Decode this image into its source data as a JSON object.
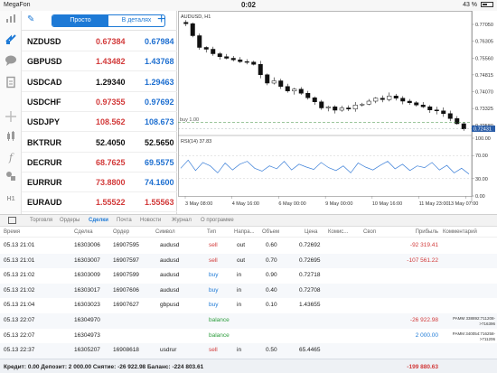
{
  "status": {
    "carrier": "MegaFon",
    "time": "0:02",
    "battery": "43 %"
  },
  "rail": {
    "icons": [
      "trade-icon",
      "accounts-icon",
      "chat-icon",
      "document-icon",
      "crosshair-icon",
      "candles-icon",
      "function-icon",
      "shapes-icon",
      "timeframe-icon"
    ],
    "timeframe": "H1"
  },
  "quotes": {
    "tab_simple": "Просто",
    "tab_details": "В деталях",
    "rows": [
      {
        "symbol": "NZDUSD",
        "bid": "0.67384",
        "ask": "0.67984",
        "bid_dir": "down",
        "ask_dir": "up"
      },
      {
        "symbol": "GBPUSD",
        "bid": "1.43482",
        "ask": "1.43768",
        "bid_dir": "down",
        "ask_dir": "up"
      },
      {
        "symbol": "USDCAD",
        "bid": "1.29340",
        "ask": "1.29463",
        "bid_dir": "flat",
        "ask_dir": "up"
      },
      {
        "symbol": "USDCHF",
        "bid": "0.97355",
        "ask": "0.97692",
        "bid_dir": "down",
        "ask_dir": "up"
      },
      {
        "symbol": "USDJPY",
        "bid": "108.562",
        "ask": "108.673",
        "bid_dir": "down",
        "ask_dir": "up"
      },
      {
        "symbol": "BKTRUR",
        "bid": "52.4050",
        "ask": "52.5650",
        "bid_dir": "flat",
        "ask_dir": "flat"
      },
      {
        "symbol": "DECRUR",
        "bid": "68.7625",
        "ask": "69.5575",
        "bid_dir": "down",
        "ask_dir": "up"
      },
      {
        "symbol": "EURRUR",
        "bid": "73.8800",
        "ask": "74.1600",
        "bid_dir": "down",
        "ask_dir": "up"
      },
      {
        "symbol": "EURAUD",
        "bid": "1.55522",
        "ask": "1.55563",
        "bid_dir": "down",
        "ask_dir": "down"
      }
    ]
  },
  "chart": {
    "title": "AUDUSD, H1",
    "price_ticks": [
      "0.77050",
      "0.76305",
      "0.75560",
      "0.74815",
      "0.74070",
      "0.73325",
      "0.72580"
    ],
    "current_price": "0.72431",
    "buy_label": "buy 1.00",
    "rsi_label": "RSI(14) 37.83",
    "rsi_ticks": [
      "100.00",
      "70.00",
      "30.00",
      "0.00"
    ],
    "time_ticks": [
      "3 May 08:00",
      "4 May 16:00",
      "6 May 00:00",
      "9 May 00:00",
      "10 May 16:00",
      "11 May 23:00",
      "13 May 07:00"
    ]
  },
  "chart_data": {
    "type": "candlestick",
    "title": "AUDUSD, H1",
    "ylim": [
      0.7213,
      0.7745
    ],
    "close_path": [
      0.7708,
      0.7655,
      0.7603,
      0.7595,
      0.7575,
      0.7562,
      0.7555,
      0.7548,
      0.754,
      0.7538,
      0.7528,
      0.7482,
      0.7445,
      0.7455,
      0.743,
      0.741,
      0.7418,
      0.74,
      0.738,
      0.7362,
      0.7335,
      0.734,
      0.7325,
      0.7335,
      0.733,
      0.7348,
      0.7352,
      0.7365,
      0.7378,
      0.7372,
      0.7388,
      0.7378,
      0.7365,
      0.7358,
      0.7348,
      0.734,
      0.7326,
      0.7322,
      0.731,
      0.7288,
      0.7265,
      0.7242
    ],
    "rsi_path": [
      48,
      62,
      44,
      58,
      52,
      40,
      57,
      45,
      55,
      60,
      48,
      43,
      52,
      47,
      60,
      45,
      55,
      50,
      46,
      58,
      49,
      44,
      52,
      40,
      57,
      50,
      45,
      53,
      60,
      47,
      55,
      44,
      52,
      49,
      58,
      45,
      53,
      40,
      48,
      38
    ],
    "rsi_ylim": [
      0,
      100
    ]
  },
  "terminal": {
    "tabs": [
      "Торговля",
      "Ордеры",
      "Сделки",
      "Почта",
      "Новости",
      "Журнал",
      "О программе"
    ],
    "active_tab": 2,
    "columns": [
      "Время",
      "Сделка",
      "Ордер",
      "Символ",
      "Тип",
      "Напра...",
      "Объем",
      "Цена",
      "Комис...",
      "Своп",
      "Прибыль",
      "Комментарий"
    ],
    "rows": [
      {
        "time": "05.13 21:01",
        "deal": "16303006",
        "order": "16907595",
        "symbol": "audusd",
        "type": "sell",
        "dir": "out",
        "volume": "0.60",
        "price": "0.72692",
        "profit": "-92 319.41",
        "comment": ""
      },
      {
        "time": "05.13 21:01",
        "deal": "16303007",
        "order": "16907597",
        "symbol": "audusd",
        "type": "sell",
        "dir": "out",
        "volume": "0.70",
        "price": "0.72695",
        "profit": "-107 561.22",
        "comment": ""
      },
      {
        "time": "05.13 21:02",
        "deal": "16303009",
        "order": "16907599",
        "symbol": "audusd",
        "type": "buy",
        "dir": "in",
        "volume": "0.90",
        "price": "0.72718",
        "profit": "",
        "comment": ""
      },
      {
        "time": "05.13 21:02",
        "deal": "16303017",
        "order": "16907606",
        "symbol": "audusd",
        "type": "buy",
        "dir": "in",
        "volume": "0.40",
        "price": "0.72708",
        "profit": "",
        "comment": ""
      },
      {
        "time": "05.13 21:04",
        "deal": "16303023",
        "order": "16907627",
        "symbol": "gbpusd",
        "type": "buy",
        "dir": "in",
        "volume": "0.10",
        "price": "1.43655",
        "profit": "",
        "comment": ""
      },
      {
        "time": "05.13 22:07",
        "deal": "16304970",
        "order": "",
        "symbol": "",
        "type": "balance",
        "dir": "",
        "volume": "",
        "price": "",
        "profit": "-26 922.98",
        "comment": "PAMM 338892:711208->716396"
      },
      {
        "time": "05.13 22:07",
        "deal": "16304973",
        "order": "",
        "symbol": "",
        "type": "balance",
        "dir": "",
        "volume": "",
        "price": "",
        "profit": "2 000.00",
        "comment": "PAMM 340054:716258->711206"
      },
      {
        "time": "05.13 22:37",
        "deal": "16305207",
        "order": "16908618",
        "symbol": "usdrur",
        "type": "sell",
        "dir": "in",
        "volume": "0.50",
        "price": "65.4465",
        "profit": "",
        "comment": ""
      }
    ],
    "summary": "Кредит: 0.00 Депозит: 2 000.00 Снятие: -26 922.98 Баланс: -224 803.61",
    "summary_total": "-199 880.63"
  }
}
